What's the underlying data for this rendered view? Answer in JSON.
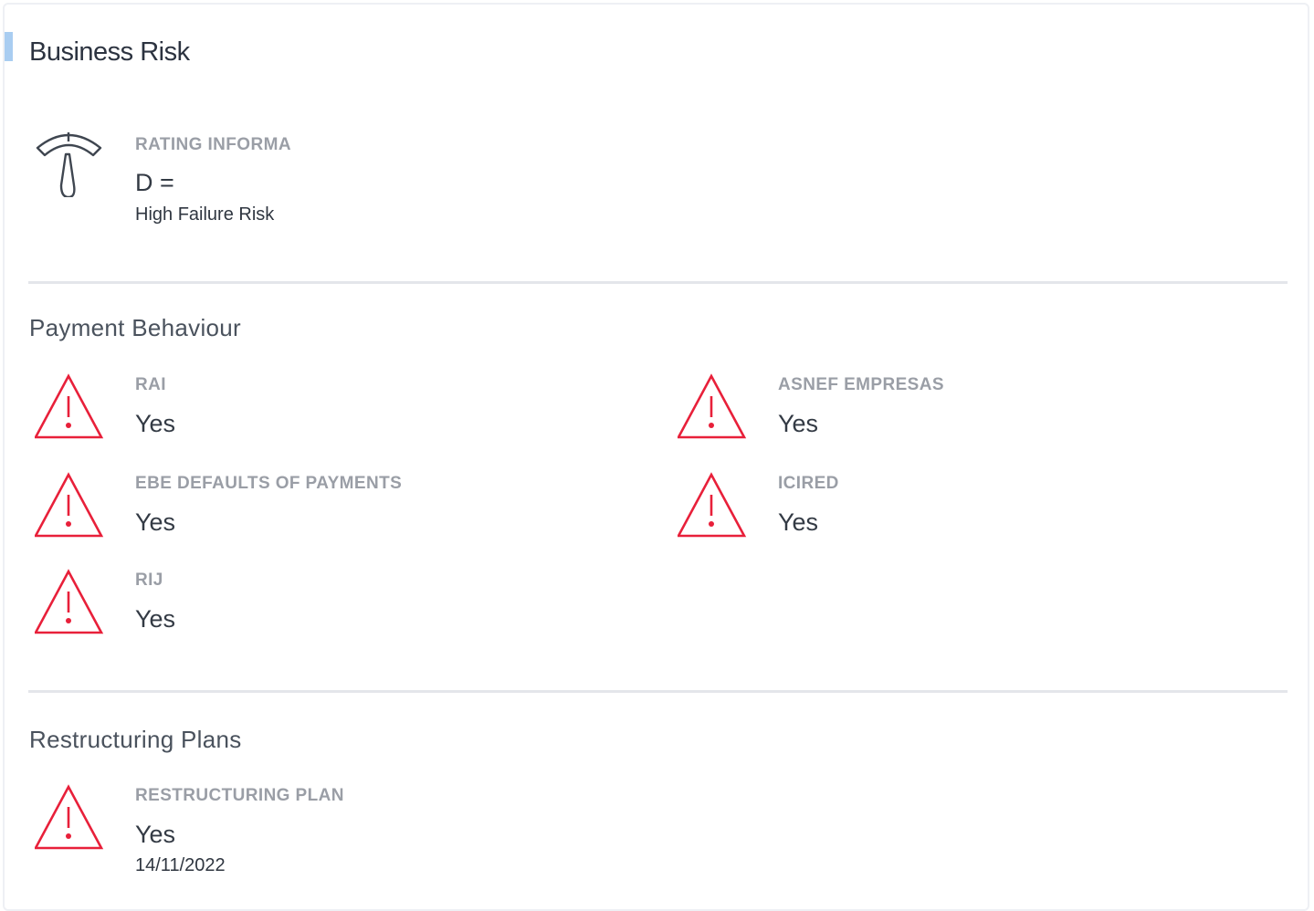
{
  "header": {
    "title": "Business Risk"
  },
  "rating": {
    "label": "RATING INFORMA",
    "value": "D =",
    "description": "High Failure Risk",
    "icon": "gauge-icon"
  },
  "payment_behaviour": {
    "title": "Payment Behaviour",
    "items": [
      {
        "label": "RAI",
        "value": "Yes",
        "icon": "warning-icon"
      },
      {
        "label": "ASNEF EMPRESAS",
        "value": "Yes",
        "icon": "warning-icon"
      },
      {
        "label": "EBE DEFAULTS OF PAYMENTS",
        "value": "Yes",
        "icon": "warning-icon"
      },
      {
        "label": "ICIRED",
        "value": "Yes",
        "icon": "warning-icon"
      },
      {
        "label": "RIJ",
        "value": "Yes",
        "icon": "warning-icon"
      }
    ]
  },
  "restructuring_plans": {
    "title": "Restructuring Plans",
    "items": [
      {
        "label": "RESTRUCTURING PLAN",
        "value": "Yes",
        "date": "14/11/2022",
        "icon": "warning-icon"
      }
    ]
  },
  "colors": {
    "warning": "#e8203a",
    "accent": "#a9cdf1",
    "label": "#9a9ea6",
    "icon_gray": "#3f4650"
  }
}
